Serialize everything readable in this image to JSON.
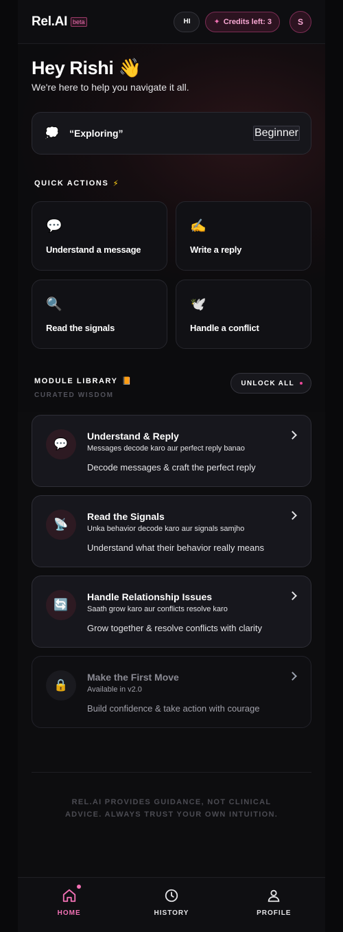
{
  "header": {
    "brand": "Rel.AI",
    "beta": "beta",
    "hi_label": "HI",
    "credits_label": "Credits left: 3",
    "avatar_initial": "S"
  },
  "greeting": {
    "title": "Hey Rishi 👋",
    "subtitle": "We're here to help you navigate it all."
  },
  "mode": {
    "icon": "💭",
    "text": "“Exploring”",
    "level": "Beginner"
  },
  "quick_actions": {
    "title": "QUICK ACTIONS",
    "items": [
      {
        "icon": "💬",
        "label": "Understand a message"
      },
      {
        "icon": "✍️",
        "label": "Write a reply"
      },
      {
        "icon": "🔍",
        "label": "Read the signals"
      },
      {
        "icon": "🕊️",
        "label": "Handle a conflict"
      }
    ]
  },
  "library": {
    "title": "MODULE LIBRARY",
    "subtitle": "CURATED WISDOM",
    "unlock_label": "UNLOCK ALL",
    "modules": [
      {
        "icon": "💬",
        "title": "Understand & Reply",
        "sub": "Messages decode karo aur perfect reply banao",
        "desc": "Decode messages & craft the perfect reply",
        "locked": false
      },
      {
        "icon": "📡",
        "title": "Read the Signals",
        "sub": "Unka behavior decode karo aur signals samjho",
        "desc": "Understand what their behavior really means",
        "locked": false
      },
      {
        "icon": "🔄",
        "title": "Handle Relationship Issues",
        "sub": "Saath grow karo aur conflicts resolve karo",
        "desc": "Grow together & resolve conflicts with clarity",
        "locked": false
      },
      {
        "icon": "🔒",
        "title": "Make the First Move",
        "sub": "Available in v2.0",
        "desc": "Build confidence & take action with courage",
        "locked": true
      }
    ]
  },
  "disclaimer": "REL.AI PROVIDES GUIDANCE, NOT CLINICAL ADVICE. ALWAYS TRUST YOUR OWN INTUITION.",
  "nav": {
    "home": "HOME",
    "history": "HISTORY",
    "profile": "PROFILE"
  },
  "colors": {
    "accent": "#f472b6",
    "background": "#09090b",
    "card": "#17171d"
  }
}
